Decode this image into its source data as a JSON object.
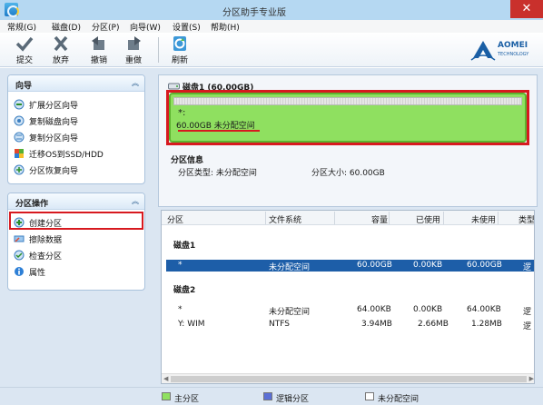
{
  "window": {
    "title": "分区助手专业版",
    "close_glyph": "✕"
  },
  "menu": [
    {
      "label": "常规(G)"
    },
    {
      "label": "磁盘(D)"
    },
    {
      "label": "分区(P)"
    },
    {
      "label": "向导(W)"
    },
    {
      "label": "设置(S)"
    },
    {
      "label": "帮助(H)"
    }
  ],
  "toolbar": {
    "commit": "提交",
    "discard": "放弃",
    "undo": "撤销",
    "redo": "重做",
    "refresh": "刷新"
  },
  "logo": {
    "name": "AOMEI",
    "sub": "TECHNOLOGY"
  },
  "wizard_panel": {
    "title": "向导",
    "items": [
      {
        "label": "扩展分区向导",
        "icon": "extend-partition-icon"
      },
      {
        "label": "复制磁盘向导",
        "icon": "copy-disk-icon"
      },
      {
        "label": "复制分区向导",
        "icon": "copy-partition-icon"
      },
      {
        "label": "迁移OS到SSD/HDD",
        "icon": "migrate-os-icon"
      },
      {
        "label": "分区恢复向导",
        "icon": "partition-recovery-icon"
      }
    ]
  },
  "partition_ops_panel": {
    "title": "分区操作",
    "items": [
      {
        "label": "创建分区",
        "icon": "create-partition-icon"
      },
      {
        "label": "擦除数据",
        "icon": "wipe-data-icon"
      },
      {
        "label": "检查分区",
        "icon": "check-partition-icon"
      },
      {
        "label": "属性",
        "icon": "properties-icon"
      }
    ]
  },
  "disk_map": {
    "disk_title": "磁盘1 (60.00GB)",
    "partition_marker": "*:",
    "partition_label": "60.00GB 未分配空间"
  },
  "partition_info": {
    "title": "分区信息",
    "type_text": "分区类型: 未分配空间",
    "size_text": "分区大小: 60.00GB"
  },
  "partition_list": {
    "columns": [
      "分区",
      "文件系统",
      "容量",
      "已使用",
      "未使用",
      "类型"
    ],
    "groups": [
      {
        "title": "磁盘1",
        "rows": [
          {
            "partition": "*",
            "fs": "未分配空间",
            "capacity": "60.00GB",
            "used": "0.00KB",
            "free": "60.00GB",
            "type": "逻",
            "selected": true
          }
        ]
      },
      {
        "title": "磁盘2",
        "rows": [
          {
            "partition": "*",
            "fs": "未分配空间",
            "capacity": "64.00KB",
            "used": "0.00KB",
            "free": "64.00KB",
            "type": "逻",
            "selected": false
          },
          {
            "partition": "Y: WIM",
            "fs": "NTFS",
            "capacity": "3.94MB",
            "used": "2.66MB",
            "free": "1.28MB",
            "type": "逻",
            "selected": false
          }
        ]
      }
    ]
  },
  "legend": {
    "items": [
      {
        "label": "主分区",
        "color": "#8fe060"
      },
      {
        "label": "逻辑分区",
        "color": "#5a6fd6"
      },
      {
        "label": "未分配空间",
        "color": "#ffffff"
      }
    ]
  },
  "colors": {
    "accent": "#1d5ea8",
    "highlight": "#d7191f",
    "partition_green": "#8fe060"
  }
}
